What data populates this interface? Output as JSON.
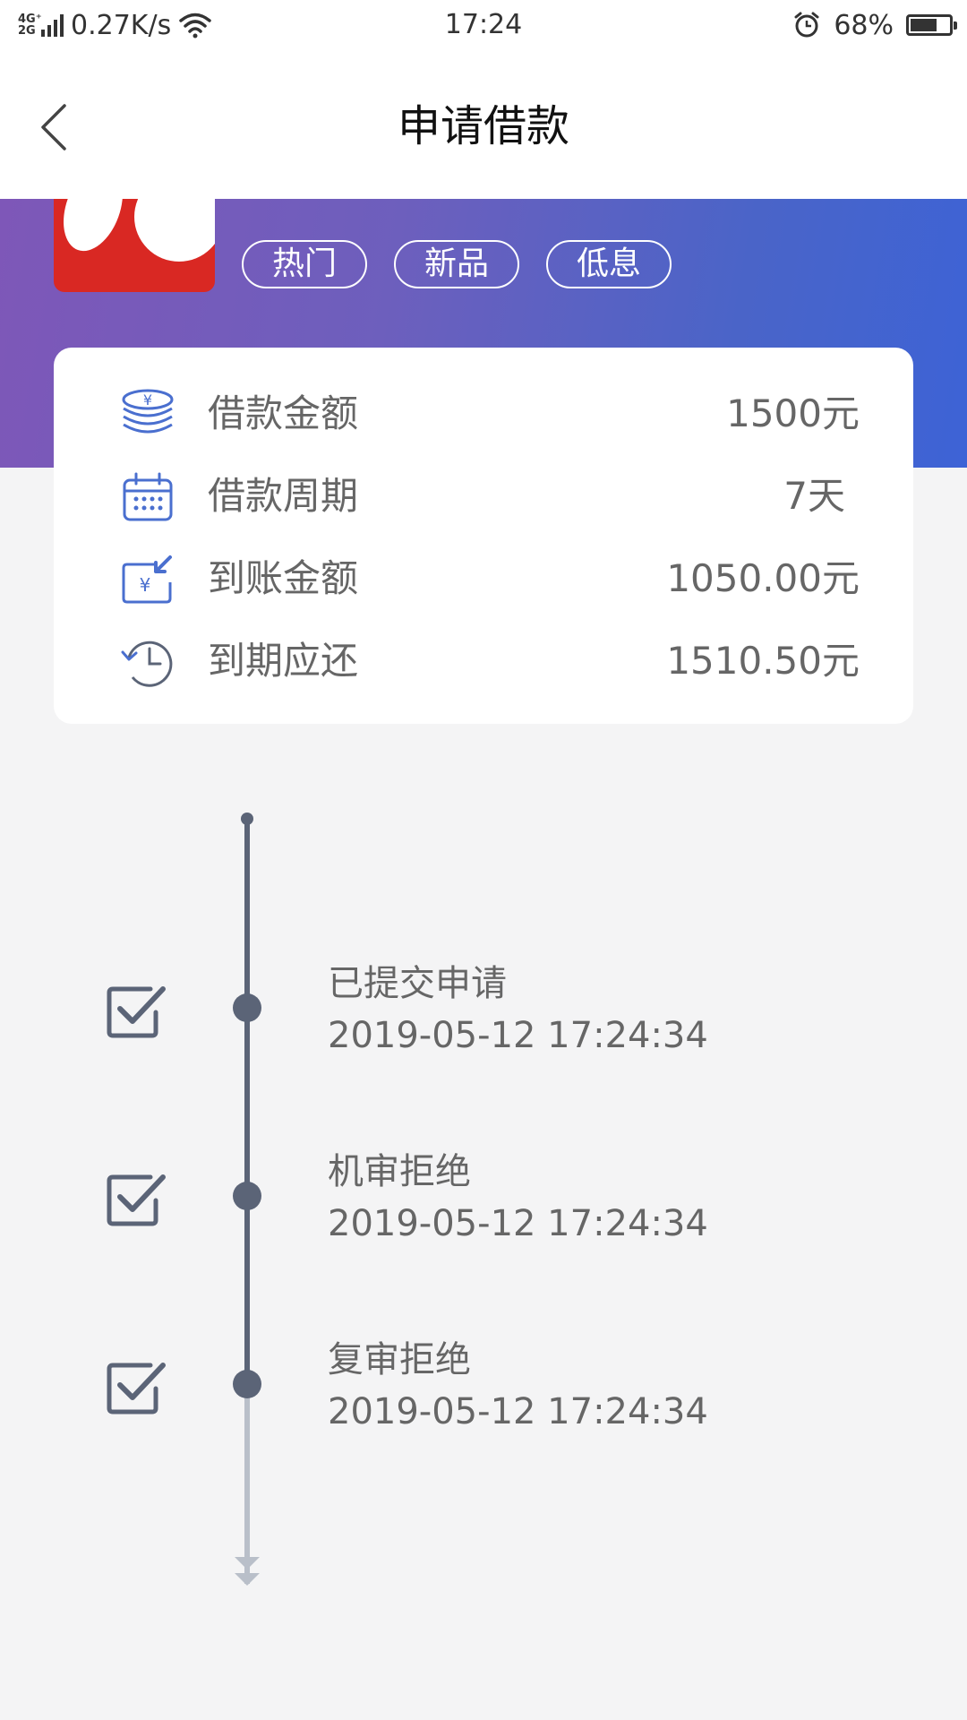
{
  "status_bar": {
    "network_type": "4G⁺\n2G",
    "net_speed": "0.27K/s",
    "time": "17:24",
    "battery": "68%",
    "battery_level": 0.68
  },
  "nav": {
    "title": "申请借款"
  },
  "tags": [
    "热门",
    "新品",
    "低息"
  ],
  "loan_card": {
    "rows": [
      {
        "icon": "coins-icon",
        "label": "借款金额",
        "value": "1500元"
      },
      {
        "icon": "calendar-icon",
        "label": "借款周期",
        "value": "7天"
      },
      {
        "icon": "money-in-icon",
        "label": "到账金额",
        "value": "1050.00元"
      },
      {
        "icon": "clock-history-icon",
        "label": "到期应还",
        "value": "1510.50元"
      }
    ]
  },
  "timeline": {
    "steps": [
      {
        "title": "已提交申请",
        "time": "2019-05-12 17:24:34"
      },
      {
        "title": "机审拒绝",
        "time": "2019-05-12 17:24:34"
      },
      {
        "title": "复审拒绝",
        "time": "2019-05-12 17:24:34"
      }
    ]
  },
  "colors": {
    "accent_blue": "#3d63d6",
    "accent_purple": "#7e57b8",
    "logo_red": "#d92823",
    "timeline_dark": "#5b6477",
    "timeline_light": "#b9bfc9",
    "icon_blue": "#4a6fcf"
  }
}
